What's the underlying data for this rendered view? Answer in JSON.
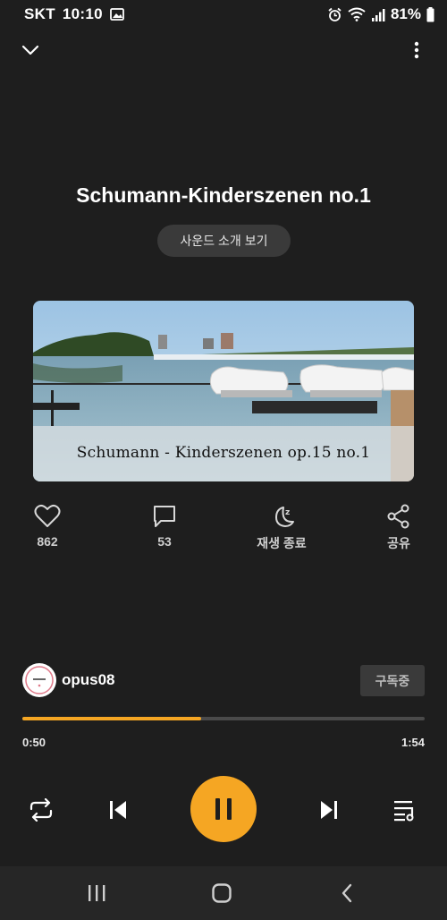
{
  "status_bar": {
    "carrier": "SKT",
    "time": "10:10",
    "battery": "81%"
  },
  "song": {
    "title": "Schumann-Kinderszenen no.1",
    "intro_button": "사운드 소개 보기"
  },
  "artwork": {
    "caption": "Schumann - Kinderszenen op.15 no.1"
  },
  "actions": [
    {
      "name": "like",
      "label": "862",
      "icon": "heart-icon"
    },
    {
      "name": "comment",
      "label": "53",
      "icon": "comment-icon"
    },
    {
      "name": "sleep-timer",
      "label": "재생 종료",
      "icon": "moon-icon"
    },
    {
      "name": "share",
      "label": "공유",
      "icon": "share-icon"
    }
  ],
  "channel": {
    "name": "opus08",
    "subscribe_label": "구독중"
  },
  "player": {
    "current_time": "0:50",
    "total_time": "1:54",
    "progress": 0.444
  },
  "colors": {
    "accent": "#f5a623",
    "background": "#1e1e1e"
  }
}
